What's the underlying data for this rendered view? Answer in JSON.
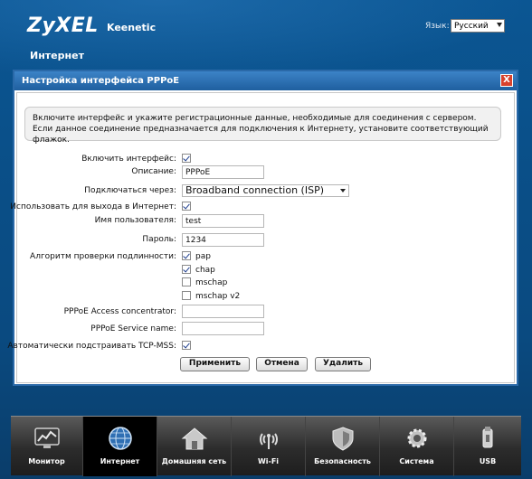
{
  "header": {
    "logo": "ZyXEL",
    "model": "Keenetic",
    "section": "Интернет",
    "language_label": "Язык:",
    "language_value": "Русский"
  },
  "dialog": {
    "title": "Настройка интерфейса PPPoE",
    "close_label": "X",
    "notice": "Включите интерфейс и укажите регистрационные данные, необходимые для соединения с сервером. Если данное соединение предназначается для подключения к Интернету, установите соответствующий флажок.",
    "fields": {
      "enable_label": "Включить интерфейс:",
      "enable_checked": true,
      "description_label": "Описание:",
      "description_value": "PPPoE",
      "connect_via_label": "Подключаться через:",
      "connect_via_value": "Broadband connection (ISP)",
      "use_internet_label": "Использовать для выхода в Интернет:",
      "use_internet_checked": true,
      "username_label": "Имя пользователя:",
      "username_value": "test",
      "password_label": "Пароль:",
      "password_value": "1234",
      "auth_label": "Алгоритм проверки подлинности:",
      "auth_options": [
        {
          "label": "pap",
          "checked": true
        },
        {
          "label": "chap",
          "checked": true
        },
        {
          "label": "mschap",
          "checked": false
        },
        {
          "label": "mschap v2",
          "checked": false
        }
      ],
      "ac_label": "PPPoE Access concentrator:",
      "ac_value": "",
      "service_label": "PPPoE Service name:",
      "service_value": "",
      "tcpmss_label": "Автоматически подстраивать TCP-MSS:",
      "tcpmss_checked": true
    },
    "buttons": {
      "apply": "Применить",
      "cancel": "Отмена",
      "delete": "Удалить"
    }
  },
  "nav": {
    "items": [
      {
        "label": "Монитор",
        "icon": "monitor-icon",
        "active": false
      },
      {
        "label": "Интернет",
        "icon": "globe-icon",
        "active": true
      },
      {
        "label": "Домашняя сеть",
        "icon": "home-icon",
        "active": false
      },
      {
        "label": "Wi-Fi",
        "icon": "wifi-icon",
        "active": false
      },
      {
        "label": "Безопасность",
        "icon": "shield-icon",
        "active": false
      },
      {
        "label": "Система",
        "icon": "gear-icon",
        "active": false
      },
      {
        "label": "USB",
        "icon": "usb-icon",
        "active": false
      }
    ]
  },
  "colors": {
    "background": "#0b4e86",
    "dialog_title": "#2a69a8",
    "nav_bg": "#2c2c2c"
  }
}
